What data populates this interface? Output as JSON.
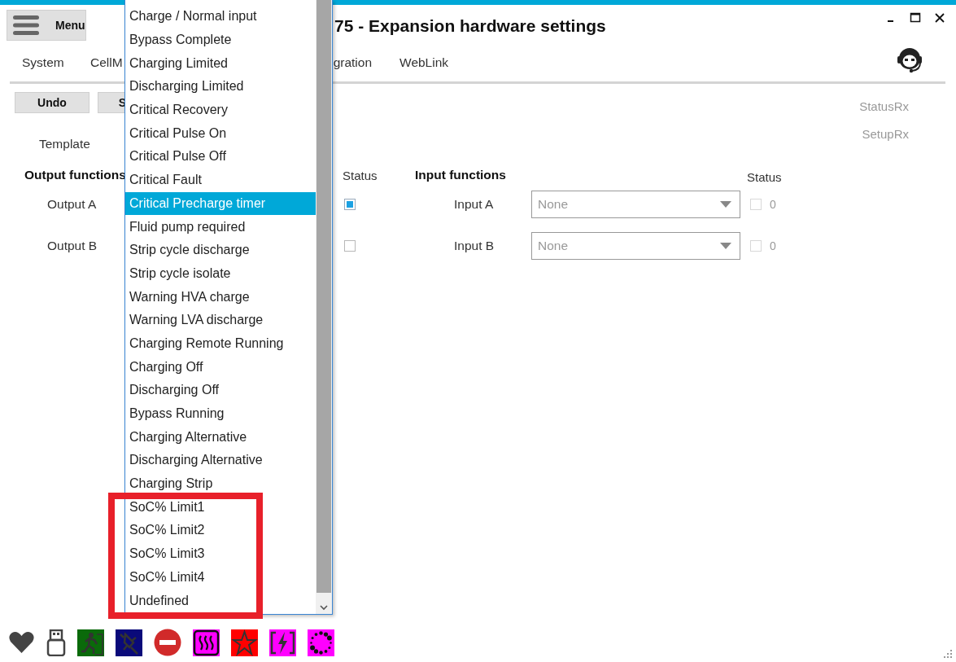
{
  "window": {
    "title": "75 - Expansion hardware settings"
  },
  "menu_button": {
    "label": "Menu"
  },
  "tabs": [
    {
      "label": "System"
    },
    {
      "label": "CellM"
    },
    {
      "label": "gration"
    },
    {
      "label": "WebLink"
    }
  ],
  "buttons": [
    {
      "label": "Undo"
    },
    {
      "label": "S"
    }
  ],
  "template": {
    "label": "Template"
  },
  "indicators": [
    {
      "label": "StatusRx"
    },
    {
      "label": "SetupRx"
    }
  ],
  "output_functions": {
    "heading": "Output functions",
    "status_heading": "Status",
    "rows": [
      {
        "label": "Output A",
        "checked": true
      },
      {
        "label": "Output B",
        "checked": false
      }
    ]
  },
  "input_functions": {
    "heading": "Input functions",
    "status_heading": "Status",
    "rows": [
      {
        "label": "Input A",
        "value": "None",
        "checked": false,
        "count": "0"
      },
      {
        "label": "Input B",
        "value": "None",
        "checked": false,
        "count": "0"
      }
    ]
  },
  "dropdown_list": {
    "items": [
      {
        "label": "Charge / Normal input",
        "selected": false
      },
      {
        "label": "Bypass Complete",
        "selected": false
      },
      {
        "label": "Charging Limited",
        "selected": false
      },
      {
        "label": "Discharging Limited",
        "selected": false
      },
      {
        "label": "Critical Recovery",
        "selected": false
      },
      {
        "label": "Critical Pulse On",
        "selected": false
      },
      {
        "label": "Critical Pulse Off",
        "selected": false
      },
      {
        "label": "Critical Fault",
        "selected": false
      },
      {
        "label": "Critical Precharge timer",
        "selected": true
      },
      {
        "label": "Fluid pump required",
        "selected": false
      },
      {
        "label": "Strip cycle discharge",
        "selected": false
      },
      {
        "label": "Strip cycle isolate",
        "selected": false
      },
      {
        "label": "Warning HVA charge",
        "selected": false
      },
      {
        "label": "Warning LVA discharge",
        "selected": false
      },
      {
        "label": "Charging Remote Running",
        "selected": false
      },
      {
        "label": "Charging Off",
        "selected": false
      },
      {
        "label": "Discharging Off",
        "selected": false
      },
      {
        "label": "Bypass Running",
        "selected": false
      },
      {
        "label": "Charging Alternative",
        "selected": false
      },
      {
        "label": "Discharging Alternative",
        "selected": false
      },
      {
        "label": "Charging Strip",
        "selected": false
      },
      {
        "label": "SoC% Limit1",
        "selected": false
      },
      {
        "label": "SoC% Limit2",
        "selected": false
      },
      {
        "label": "SoC% Limit3",
        "selected": false
      },
      {
        "label": "SoC% Limit4",
        "selected": false
      },
      {
        "label": "Undefined",
        "selected": false
      }
    ]
  }
}
